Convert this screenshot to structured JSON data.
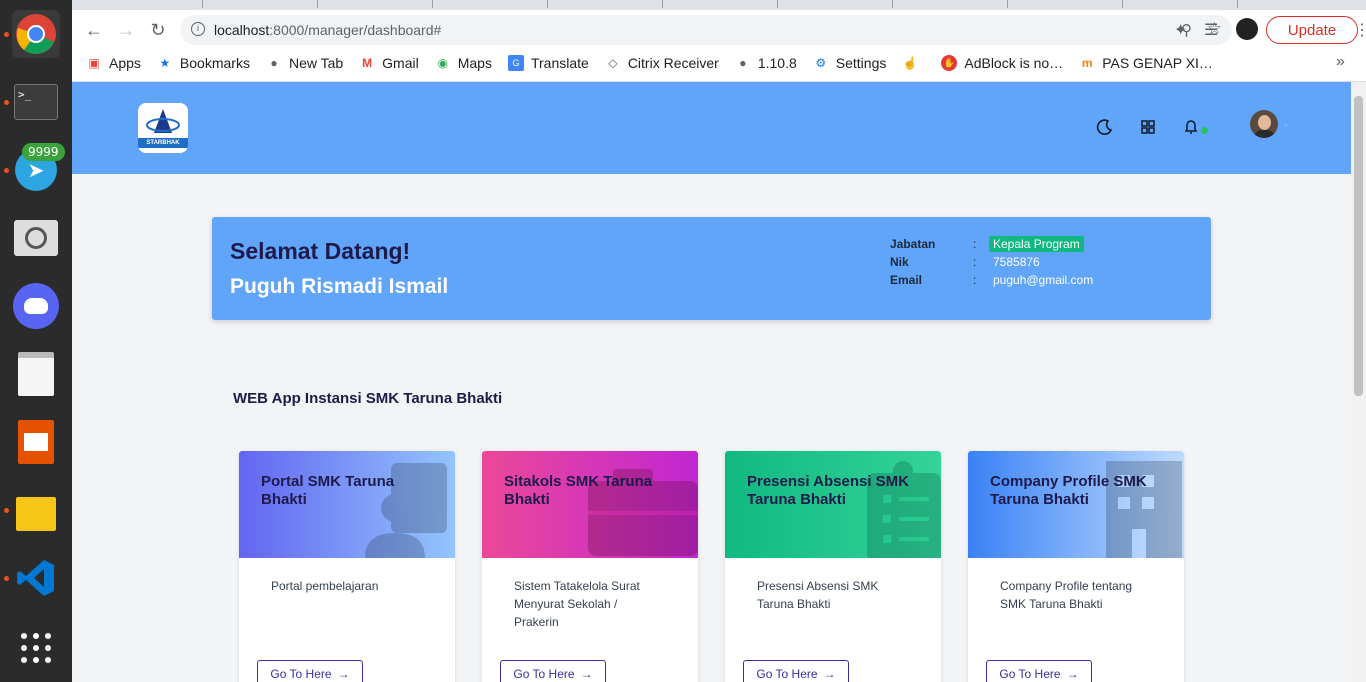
{
  "dock": {
    "badge": "9999",
    "items": [
      "chrome-icon",
      "terminal-icon",
      "telegram-icon",
      "magnifier-icon",
      "discord-icon",
      "text-editor-icon",
      "presentation-icon",
      "notes-icon",
      "vscode-icon",
      "app-grid-icon"
    ]
  },
  "browser": {
    "url_host": "localhost",
    "url_path": ":8000/manager/dashboard#",
    "update_label": "Update",
    "bookmarks": [
      {
        "label": "Apps",
        "icon": "apps-grid-icon"
      },
      {
        "label": "Bookmarks",
        "icon": "star-icon"
      },
      {
        "label": "New Tab",
        "icon": "globe-icon"
      },
      {
        "label": "Gmail",
        "icon": "gmail-icon"
      },
      {
        "label": "Maps",
        "icon": "maps-pin-icon"
      },
      {
        "label": "Translate",
        "icon": "translate-icon"
      },
      {
        "label": "Citrix Receiver",
        "icon": "lock-icon"
      },
      {
        "label": "1.10.8",
        "icon": "globe-icon"
      },
      {
        "label": "Settings",
        "icon": "gear-icon"
      },
      {
        "label": "",
        "icon": "pointer-icon"
      },
      {
        "label": "AdBlock is no…",
        "icon": "adblock-icon"
      },
      {
        "label": "PAS GENAP XI…",
        "icon": "moodle-icon"
      }
    ],
    "more": "»"
  },
  "app": {
    "logo_text": "STARBHAK",
    "welcome": {
      "greeting": "Selamat Datang!",
      "name": "Puguh Rismadi Ismail",
      "fields": [
        {
          "key": "Jabatan",
          "sep": ":",
          "value": "Kepala Program"
        },
        {
          "key": "Nik",
          "sep": ":",
          "value": "7585876"
        },
        {
          "key": "Email",
          "sep": ":",
          "value": "puguh@gmail.com"
        }
      ]
    },
    "section_title": "WEB App Instansi SMK Taruna Bhakti",
    "cards": [
      {
        "title": "Portal SMK Taruna Bhakti",
        "desc": "Portal pembelajaran",
        "button": "Go To Here",
        "gradient": [
          "#6366f1",
          "#93c5fd"
        ]
      },
      {
        "title": "Sitakols SMK Taruna Bhakti",
        "desc": "Sistem Tatakelola Surat Menyurat Sekolah / Prakerin",
        "button": "Go To Here",
        "gradient": [
          "#ec4899",
          "#c026d3"
        ]
      },
      {
        "title": "Presensi Absensi SMK Taruna Bhakti",
        "desc": "Presensi Absensi SMK Taruna Bhakti",
        "button": "Go To Here",
        "gradient": [
          "#10b981",
          "#34d399"
        ]
      },
      {
        "title": "Company Profile SMK Taruna Bhakti",
        "desc": "Company Profile tentang SMK Taruna Bhakti",
        "button": "Go To Here",
        "gradient": [
          "#3b82f6",
          "#bfdbfe"
        ]
      }
    ]
  }
}
